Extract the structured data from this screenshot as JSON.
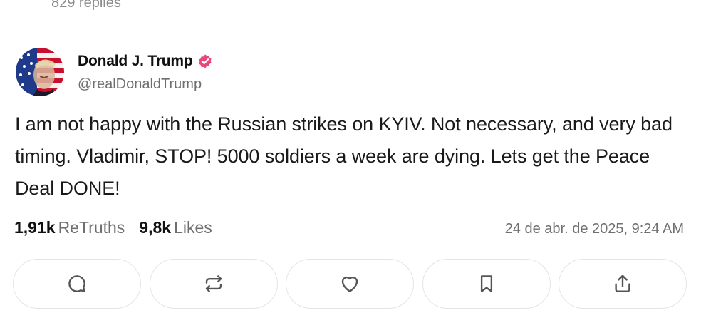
{
  "previous_post": {
    "replies_label": "829 replies"
  },
  "author": {
    "display_name": "Donald J. Trump",
    "handle": "@realDonaldTrump",
    "verified": true,
    "avatar_icon": "flag-portrait-avatar"
  },
  "post": {
    "text": "I am not happy with the Russian strikes on KYIV. Not necessary, and very bad timing. Vladimir, STOP! 5000 soldiers a week are dying. Lets get the Peace Deal DONE!"
  },
  "stats": {
    "retruths_count": "1,91k",
    "retruths_label": "ReTruths",
    "likes_count": "9,8k",
    "likes_label": "Likes",
    "timestamp": "24 de abr. de 2025, 9:24 AM"
  },
  "actions": [
    {
      "name": "reply",
      "icon": "comment-icon"
    },
    {
      "name": "retruth",
      "icon": "repost-icon"
    },
    {
      "name": "like",
      "icon": "heart-icon"
    },
    {
      "name": "bookmark",
      "icon": "bookmark-icon"
    },
    {
      "name": "share",
      "icon": "share-icon"
    }
  ],
  "colors": {
    "verified_badge": "#e8467c",
    "muted_text": "#6f6f6f",
    "button_border": "#e4e4e7"
  }
}
